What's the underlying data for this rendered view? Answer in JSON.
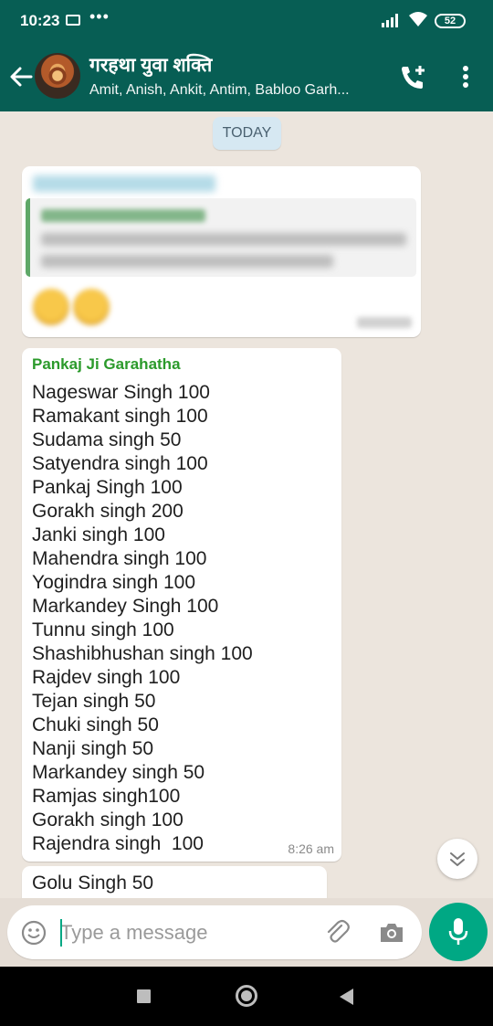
{
  "status_bar": {
    "time": "10:23",
    "dots": "•••",
    "battery": "52"
  },
  "header": {
    "group_name": "गरहथा युवा शक्ति",
    "members": "Amit, Anish, Ankit, Antim, Babloo Garh..."
  },
  "chat": {
    "date_label": "TODAY",
    "message2": {
      "sender": "Pankaj Ji Garahatha",
      "lines": [
        "Nageswar Singh 100",
        "Ramakant singh 100",
        "Sudama singh 50",
        "Satyendra singh 100",
        "Pankaj Singh 100",
        "Gorakh singh 200",
        "Janki singh 100",
        "Mahendra singh 100",
        "Yogindra singh 100",
        "Markandey Singh 100",
        "Tunnu singh 100",
        "Shashibhushan singh 100",
        "Rajdev singh 100",
        "Tejan singh 50",
        "Chuki singh 50",
        "Nanji singh 50",
        "Markandey singh 50",
        "Ramjas singh100",
        "Gorakh singh 100",
        "Rajendra singh  100"
      ],
      "time": "8:26 am"
    },
    "message3": {
      "text": "Golu Singh 50"
    }
  },
  "input": {
    "placeholder": "Type a message"
  },
  "colors": {
    "header": "#075e54",
    "accent": "#00a884",
    "sender_green": "#2b9a2b"
  },
  "icons": [
    "back-arrow-icon",
    "add-call-icon",
    "more-vert-icon",
    "scroll-down-icon",
    "emoji-icon",
    "attach-icon",
    "camera-icon",
    "mic-icon"
  ]
}
